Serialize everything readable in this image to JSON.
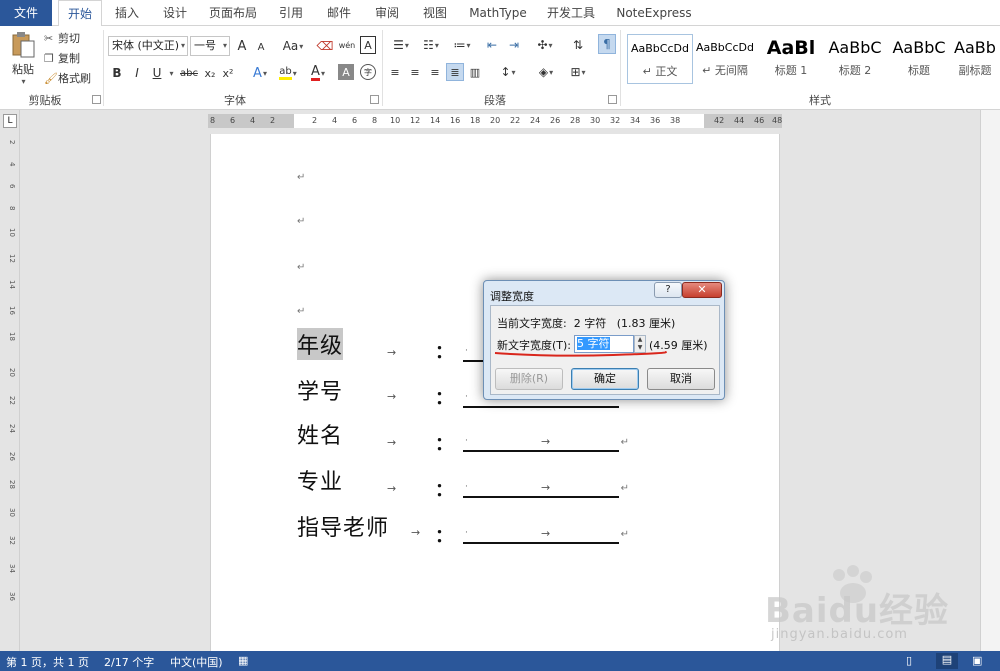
{
  "tabs": [
    "文件",
    "开始",
    "插入",
    "设计",
    "页面布局",
    "引用",
    "邮件",
    "审阅",
    "视图",
    "MathType",
    "开发工具",
    "NoteExpress"
  ],
  "clipboard": {
    "paste": "粘贴",
    "cut": "剪切",
    "copy": "复制",
    "format_painter": "格式刷",
    "group": "剪贴板"
  },
  "font": {
    "name": "宋体 (中文正)",
    "size": "一号",
    "bold": "B",
    "italic": "I",
    "underline": "U",
    "strike": "abc",
    "sub": "x₂",
    "sup": "x²",
    "grow": "A",
    "shrink": "A",
    "case": "Aa",
    "pinyin": "wén",
    "border_char": "A",
    "text_effect": "A",
    "highlight": "ab",
    "font_color": "A",
    "shade": "A",
    "enclose": "字",
    "group": "字体"
  },
  "paragraph": {
    "group": "段落"
  },
  "styles": {
    "group": "样式",
    "items": [
      {
        "sample": "AaBbCcDd",
        "name": "↵ 正文"
      },
      {
        "sample": "AaBbCcDd",
        "name": "↵ 无间隔"
      },
      {
        "sample": "AaBl",
        "name": "标题 1"
      },
      {
        "sample": "AaBbC",
        "name": "标题 2"
      },
      {
        "sample": "AaBbC",
        "name": "标题"
      },
      {
        "sample": "AaBb",
        "name": "副标题"
      }
    ]
  },
  "ruler": {
    "h_ticks": [
      "8",
      "6",
      "4",
      "2",
      "",
      "2",
      "4",
      "6",
      "8",
      "10",
      "12",
      "14",
      "16",
      "18",
      "20",
      "22",
      "24",
      "26",
      "28",
      "30",
      "32",
      "34",
      "36",
      "38",
      "",
      "42",
      "44",
      "46",
      "48"
    ],
    "v_ticks": [
      "2",
      "4",
      "6",
      "8",
      "10",
      "12",
      "14",
      "16",
      "18",
      "20",
      "22",
      "24",
      "26",
      "28",
      "30",
      "32",
      "34",
      "36"
    ],
    "tab_marker": "L"
  },
  "document": {
    "para_mark": "↵",
    "tab_arrow": "→",
    "colon": "：",
    "rows": [
      "年级",
      "学号",
      "姓名",
      "专业",
      "指导老师"
    ]
  },
  "dialog": {
    "title": "调整宽度",
    "help": "?",
    "close": "✕",
    "current_label": "当前文字宽度:",
    "current_value": "2 字符",
    "current_cm": "(1.83 厘米)",
    "new_label": "新文字宽度(T):",
    "new_value": "5 字符",
    "new_cm": "(4.59 厘米)",
    "delete_btn": "删除(R)",
    "ok_btn": "确定",
    "cancel_btn": "取消"
  },
  "status": {
    "page": "第 1 页，共 1 页",
    "words": "2/17 个字",
    "lang": "中文(中国)"
  },
  "watermark": {
    "main": "Baidu经验",
    "url": "jingyan.baidu.com"
  },
  "colors": {
    "accent": "#2b579a",
    "annotation_red": "#d9261c",
    "selection": "#3399ff"
  }
}
